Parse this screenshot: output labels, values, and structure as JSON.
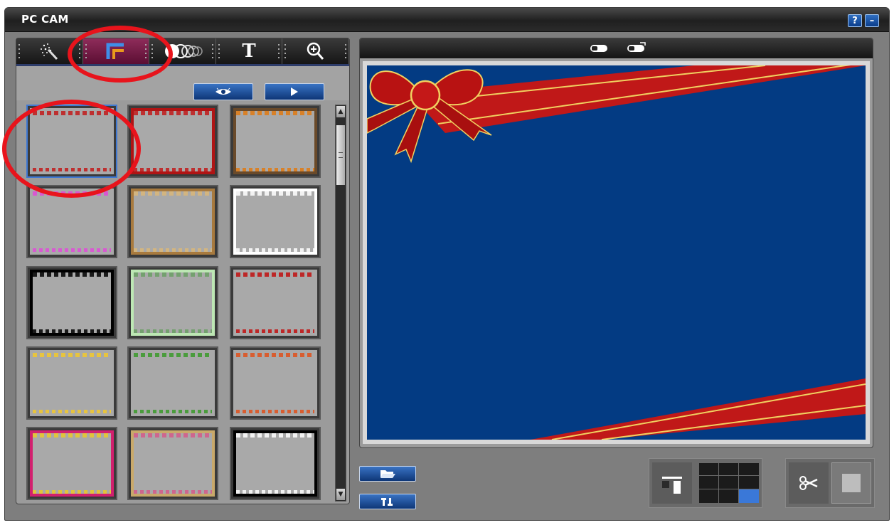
{
  "window": {
    "title": "PC CAM",
    "help_label": "?",
    "minimize_label": "–"
  },
  "tabs": [
    {
      "name": "effects",
      "icon": "sparkle-wand-icon",
      "active": false
    },
    {
      "name": "frames",
      "icon": "frame-corner-icon",
      "active": true
    },
    {
      "name": "motion",
      "icon": "motion-trail-icon",
      "active": false
    },
    {
      "name": "text",
      "icon": "text-t-icon",
      "label": "T",
      "active": false
    },
    {
      "name": "zoom",
      "icon": "zoom-in-icon",
      "active": false
    }
  ],
  "toolbar": {
    "preview_icon": "eye-icon",
    "apply_icon": "play-arrow-icon"
  },
  "frames": [
    {
      "id": "ribbon-bow",
      "selected": true,
      "border": "#a9a9a9",
      "accent": "#c11a1a"
    },
    {
      "id": "red-flowers",
      "selected": false,
      "border": "#b01414",
      "accent": "#c11a1a"
    },
    {
      "id": "autumn-leaves",
      "selected": false,
      "border": "#6a4a2a",
      "accent": "#e07a12"
    },
    {
      "id": "rainbow-bars",
      "selected": false,
      "border": "#a9a9a9",
      "accent": "#e04bd8"
    },
    {
      "id": "wooden-gold",
      "selected": false,
      "border": "#a87a3e",
      "accent": "#d9b77a"
    },
    {
      "id": "white-stamp",
      "selected": false,
      "border": "#ffffff",
      "accent": "#ffffff"
    },
    {
      "id": "black-film",
      "selected": false,
      "border": "#000000",
      "accent": "#000000"
    },
    {
      "id": "green-glass",
      "selected": false,
      "border": "#bde7b4",
      "accent": "#6a9e65"
    },
    {
      "id": "red-roses",
      "selected": false,
      "border": "#a9a9a9",
      "accent": "#c11010"
    },
    {
      "id": "balloons",
      "selected": false,
      "border": "#a9a9a9",
      "accent": "#f2c92c"
    },
    {
      "id": "grass-birds",
      "selected": false,
      "border": "#a9a9a9",
      "accent": "#3a9a2a"
    },
    {
      "id": "orange-lights",
      "selected": false,
      "border": "#a9a9a9",
      "accent": "#e0501a"
    },
    {
      "id": "pink-candles",
      "selected": false,
      "border": "#d2206e",
      "accent": "#e9c92a"
    },
    {
      "id": "confetti",
      "selected": false,
      "border": "#c9a96a",
      "accent": "#d45a8a"
    },
    {
      "id": "piano-keys",
      "selected": false,
      "border": "#000000",
      "accent": "#ffffff"
    }
  ],
  "preview": {
    "background": "#033b83",
    "ribbon_color": "#c01818",
    "header_icons": [
      "camera-icon",
      "camera-flip-icon"
    ]
  },
  "bottom": {
    "open_folder_icon": "folder-open-icon",
    "settings_icon": "tools-icon",
    "layout_single_icon": "single-layout-icon",
    "layout_grid_icon": "grid-layout-icon",
    "cut_icon": "scissors-icon",
    "stop_icon": "square-icon"
  }
}
